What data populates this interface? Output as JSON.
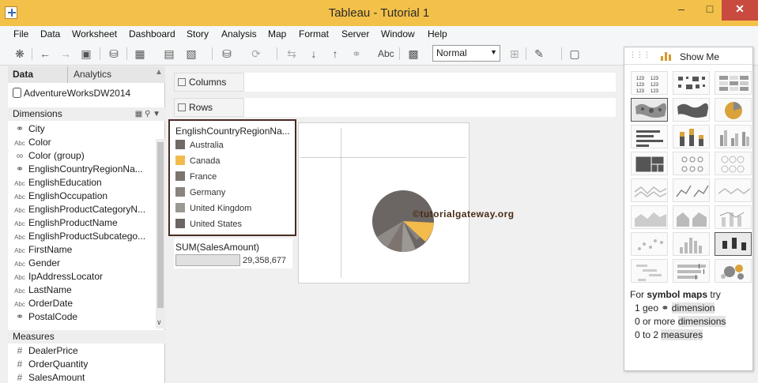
{
  "window": {
    "title": "Tableau - Tutorial 1",
    "minimize": "–",
    "maximize": "□",
    "close": "✕"
  },
  "menu": [
    "File",
    "Data",
    "Worksheet",
    "Dashboard",
    "Story",
    "Analysis",
    "Map",
    "Format",
    "Server",
    "Window",
    "Help"
  ],
  "toolbar": {
    "fit_select": "Normal",
    "abc_label": "Abc"
  },
  "left_pane": {
    "tabs": {
      "data": "Data",
      "analytics": "Analytics"
    },
    "datasource": "AdventureWorksDW2014",
    "dimensions_header": "Dimensions",
    "dimensions": [
      {
        "type": "globe",
        "name": "City"
      },
      {
        "type": "Abc",
        "name": "Color"
      },
      {
        "type": "clip",
        "name": "Color (group)"
      },
      {
        "type": "globe",
        "name": "EnglishCountryRegionNa..."
      },
      {
        "type": "Abc",
        "name": "EnglishEducation"
      },
      {
        "type": "Abc",
        "name": "EnglishOccupation"
      },
      {
        "type": "Abc",
        "name": "EnglishProductCategoryN..."
      },
      {
        "type": "Abc",
        "name": "EnglishProductName"
      },
      {
        "type": "Abc",
        "name": "EnglishProductSubcatego..."
      },
      {
        "type": "Abc",
        "name": "FirstName"
      },
      {
        "type": "Abc",
        "name": "Gender"
      },
      {
        "type": "Abc",
        "name": "IpAddressLocator"
      },
      {
        "type": "Abc",
        "name": "LastName"
      },
      {
        "type": "Abc",
        "name": "OrderDate"
      },
      {
        "type": "globe",
        "name": "PostalCode"
      }
    ],
    "measures_header": "Measures",
    "measures": [
      {
        "type": "#",
        "name": "DealerPrice"
      },
      {
        "type": "#",
        "name": "OrderQuantity"
      },
      {
        "type": "#",
        "name": "SalesAmount"
      }
    ]
  },
  "shelves": {
    "columns": "Columns",
    "rows": "Rows"
  },
  "color_legend": {
    "title": "EnglishCountryRegionNa...",
    "items": [
      {
        "label": "Australia",
        "color": "#6f6a66"
      },
      {
        "label": "Canada",
        "color": "#f2bb4c"
      },
      {
        "label": "France",
        "color": "#7d7470"
      },
      {
        "label": "Germany",
        "color": "#8a8480"
      },
      {
        "label": "United Kingdom",
        "color": "#9c9894"
      },
      {
        "label": "United States",
        "color": "#6b6663"
      }
    ]
  },
  "size_legend": {
    "title": "SUM(SalesAmount)",
    "value": "29,358,677"
  },
  "watermark": "©tutorialgateway.org",
  "show_me": {
    "title": "Show Me",
    "help_intro": "For",
    "help_bold": "symbol maps",
    "help_try": "try",
    "req1_prefix": "1 geo",
    "req1_suffix": "dimension",
    "req2_prefix": "0 or more",
    "req2_suffix": "dimensions",
    "req3_prefix": "0 to 2",
    "req3_suffix": "measures"
  }
}
